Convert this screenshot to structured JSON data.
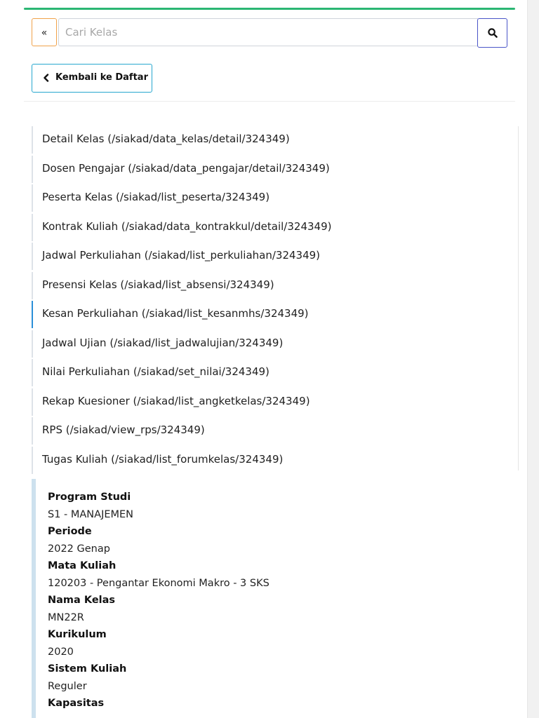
{
  "search": {
    "toggle_label": "«",
    "placeholder": "Cari Kelas",
    "value": ""
  },
  "back_button": {
    "label": "Kembali ke Daftar"
  },
  "nav": {
    "items": [
      {
        "label": "Detail Kelas (/siakad/data_kelas/detail/324349)",
        "active": false
      },
      {
        "label": "Dosen Pengajar (/siakad/data_pengajar/detail/324349)",
        "active": false
      },
      {
        "label": "Peserta Kelas (/siakad/list_peserta/324349)",
        "active": false
      },
      {
        "label": "Kontrak Kuliah (/siakad/data_kontrakkul/detail/324349)",
        "active": false
      },
      {
        "label": "Jadwal Perkuliahan (/siakad/list_perkuliahan/324349)",
        "active": false
      },
      {
        "label": "Presensi Kelas (/siakad/list_absensi/324349)",
        "active": false
      },
      {
        "label": "Kesan Perkuliahan (/siakad/list_kesanmhs/324349)",
        "active": true
      },
      {
        "label": "Jadwal Ujian (/siakad/list_jadwalujian/324349)",
        "active": false
      },
      {
        "label": "Nilai Perkuliahan (/siakad/set_nilai/324349)",
        "active": false
      },
      {
        "label": "Rekap Kuesioner (/siakad/list_angketkelas/324349)",
        "active": false
      },
      {
        "label": "RPS (/siakad/view_rps/324349)",
        "active": false
      },
      {
        "label": "Tugas Kuliah (/siakad/list_forumkelas/324349)",
        "active": false
      }
    ]
  },
  "info": {
    "fields": [
      {
        "label": "Program Studi",
        "value": "S1 - MANAJEMEN"
      },
      {
        "label": "Periode",
        "value": "2022 Genap"
      },
      {
        "label": "Mata Kuliah",
        "value": "120203 - Pengantar Ekonomi Makro - 3 SKS"
      },
      {
        "label": "Nama Kelas",
        "value": "MN22R"
      },
      {
        "label": "Kurikulum",
        "value": "2020"
      },
      {
        "label": "Sistem Kuliah",
        "value": "Reguler"
      },
      {
        "label": "Kapasitas",
        "value": ""
      }
    ]
  },
  "colors": {
    "top_accent": "#2bb673",
    "toggle_border": "#f0a24a",
    "search_button_border": "#4a55c8",
    "back_button_border": "#27a7cf",
    "nav_active_border": "#2a8fd8",
    "info_panel_border": "#cde1ee"
  },
  "icons": {
    "search": "search-icon",
    "back": "chevron-left-icon"
  }
}
